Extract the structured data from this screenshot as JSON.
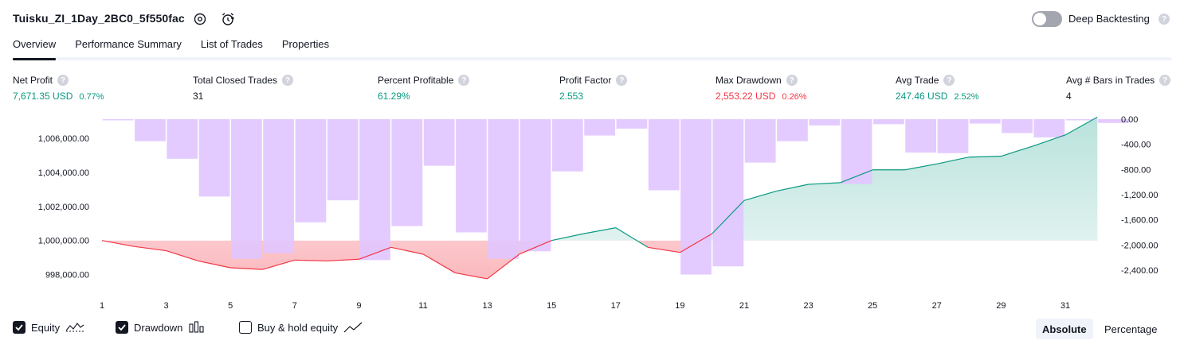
{
  "header": {
    "strategy_name": "Tuisku_ZI_1Day_2BC0_5f550fac",
    "deep_backtesting_label": "Deep Backtesting",
    "help_glyph": "?"
  },
  "tabs": [
    "Overview",
    "Performance Summary",
    "List of Trades",
    "Properties"
  ],
  "metrics": [
    {
      "label": "Net Profit",
      "value": "7,671.35 USD",
      "pct": "0.77%",
      "tone": "green"
    },
    {
      "label": "Total Closed Trades",
      "value": "31",
      "pct": "",
      "tone": "dark"
    },
    {
      "label": "Percent Profitable",
      "value": "61.29%",
      "pct": "",
      "tone": "green"
    },
    {
      "label": "Profit Factor",
      "value": "2.553",
      "pct": "",
      "tone": "green"
    },
    {
      "label": "Max Drawdown",
      "value": "2,553.22 USD",
      "pct": "0.26%",
      "tone": "red"
    },
    {
      "label": "Avg Trade",
      "value": "247.46 USD",
      "pct": "2.52%",
      "tone": "green"
    },
    {
      "label": "Avg # Bars in Trades",
      "value": "4",
      "pct": "",
      "tone": "dark"
    }
  ],
  "legend": {
    "equity": "Equity",
    "drawdown": "Drawdown",
    "buy_hold": "Buy & hold equity",
    "absolute": "Absolute",
    "percentage": "Percentage"
  },
  "colors": {
    "equity_up": "#089981",
    "equity_down": "#f23645",
    "drawdown_bar": "#e1c5ff"
  },
  "chart_data": {
    "type": "bar",
    "x": [
      1,
      2,
      3,
      4,
      5,
      6,
      7,
      8,
      9,
      10,
      11,
      12,
      13,
      14,
      15,
      16,
      17,
      18,
      19,
      20,
      21,
      22,
      23,
      24,
      25,
      26,
      27,
      28,
      29,
      30,
      31,
      32
    ],
    "x_tick_labels": [
      "1",
      "3",
      "5",
      "7",
      "9",
      "11",
      "13",
      "15",
      "17",
      "19",
      "21",
      "23",
      "25",
      "27",
      "29",
      "31"
    ],
    "left_axis": {
      "ticks": [
        "1,006,000.00",
        "1,004,000.00",
        "1,002,000.00",
        "1,000,000.00",
        "998,000.00"
      ],
      "ylim": [
        997000,
        1007500
      ]
    },
    "right_axis": {
      "ticks": [
        "0.00",
        "-400.00",
        "-800.00",
        "-1,200.00",
        "-1,600.00",
        "-2,000.00",
        "-2,400.00"
      ],
      "ylim": [
        -2700,
        100
      ]
    },
    "series": [
      {
        "name": "Equity",
        "type": "line",
        "axis": "left",
        "values": [
          1000000,
          999650,
          999400,
          998800,
          998400,
          998300,
          998850,
          998800,
          998900,
          999600,
          999200,
          998100,
          997750,
          999200,
          1000000,
          1000400,
          1000750,
          999600,
          999300,
          1000400,
          1002350,
          1002900,
          1003300,
          1003400,
          1004150,
          1004150,
          1004500,
          1004900,
          1004950,
          1005550,
          1006200,
          1007250
        ]
      },
      {
        "name": "Drawdown",
        "type": "bar",
        "axis": "right",
        "values": [
          -5,
          -350,
          -630,
          -1230,
          -2220,
          -2130,
          -1640,
          -1290,
          -2240,
          -1700,
          -740,
          -1800,
          -2220,
          -2100,
          -830,
          -260,
          -150,
          -1130,
          -2470,
          -2340,
          -690,
          -350,
          -100,
          -1030,
          -80,
          -530,
          -540,
          -70,
          -220,
          -290,
          -5,
          -60
        ]
      }
    ]
  }
}
